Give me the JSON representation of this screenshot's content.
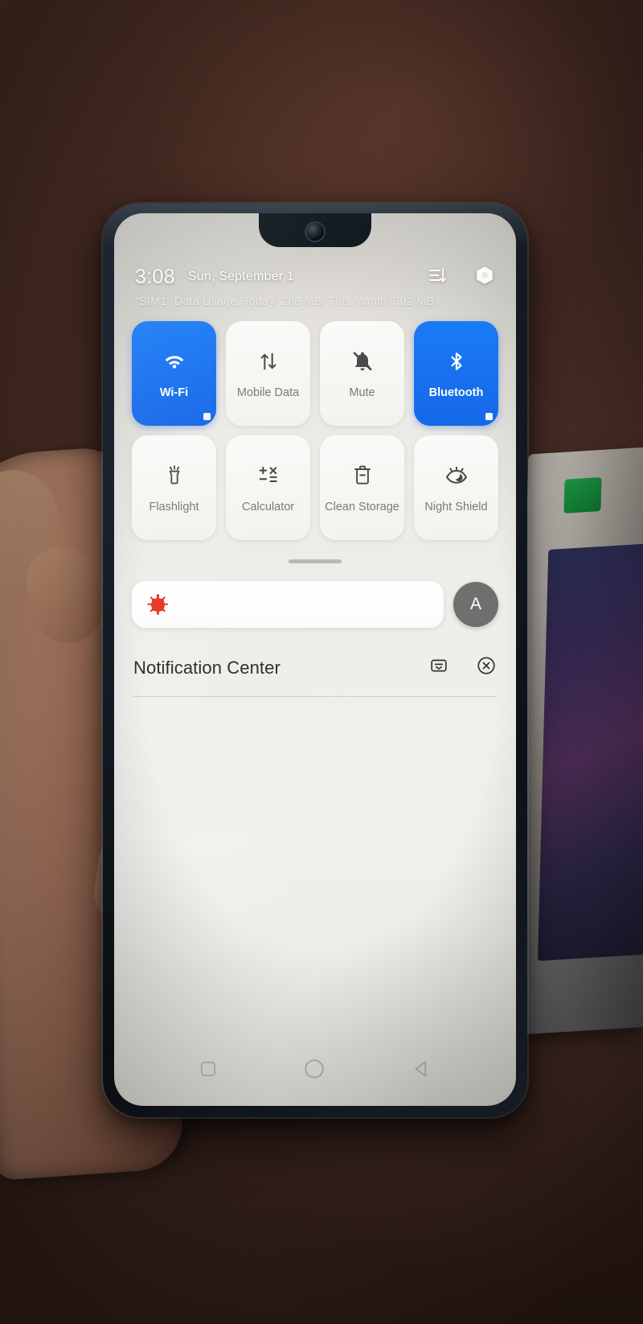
{
  "status_bar": {
    "time": "3:08",
    "date": "Sun, September 1",
    "sort_icon": "sort-descending-icon",
    "settings_icon": "hexagon-gear-icon"
  },
  "data_usage": {
    "text": "\"SIM1\" Data Usage, Today: 288 MB, This Month: 302 MB"
  },
  "quick_settings": {
    "accent_on_color": "#1a7bf5",
    "tiles": [
      {
        "label": "Wi-Fi",
        "icon": "wifi-icon",
        "active": true
      },
      {
        "label": "Mobile Data",
        "icon": "mobile-data-arrows-icon",
        "active": false
      },
      {
        "label": "Mute",
        "icon": "bell-muted-icon",
        "active": false
      },
      {
        "label": "Bluetooth",
        "icon": "bluetooth-icon",
        "active": true
      },
      {
        "label": "Flashlight",
        "icon": "flashlight-icon",
        "active": false
      },
      {
        "label": "Calculator",
        "icon": "calculator-icon",
        "active": false
      },
      {
        "label": "Clean Storage",
        "icon": "trash-minus-icon",
        "active": false
      },
      {
        "label": "Night Shield",
        "icon": "eye-moon-icon",
        "active": false
      }
    ]
  },
  "brightness": {
    "sun_icon": "brightness-sun-icon",
    "sun_color": "#e8392a",
    "auto_label": "A",
    "auto_icon": "auto-brightness-button",
    "slider_value": 0
  },
  "notification_center": {
    "title": "Notification Center",
    "manage_icon": "notification-settings-icon",
    "clear_icon": "clear-all-circle-x-icon",
    "items": []
  },
  "nav_bar": {
    "recents_icon": "square-recents-icon",
    "home_icon": "circle-home-icon",
    "back_icon": "triangle-back-icon"
  }
}
